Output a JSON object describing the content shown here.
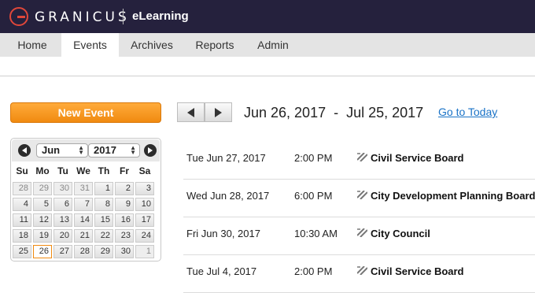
{
  "header": {
    "brand": "GRANICUS",
    "product": "eLearning"
  },
  "nav": {
    "tabs": [
      "Home",
      "Events",
      "Archives",
      "Reports",
      "Admin"
    ],
    "active": "Events"
  },
  "toolbar": {
    "new_event_label": "New Event",
    "date_range": "Jun 26, 2017  -  Jul 25, 2017",
    "go_to_today_label": "Go to Today"
  },
  "calendar": {
    "month": "Jun",
    "year": "2017",
    "weekdays": [
      "Su",
      "Mo",
      "Tu",
      "We",
      "Th",
      "Fr",
      "Sa"
    ],
    "weeks": [
      [
        "28",
        "29",
        "30",
        "31",
        "1",
        "2",
        "3"
      ],
      [
        "4",
        "5",
        "6",
        "7",
        "8",
        "9",
        "10"
      ],
      [
        "11",
        "12",
        "13",
        "14",
        "15",
        "16",
        "17"
      ],
      [
        "18",
        "19",
        "20",
        "21",
        "22",
        "23",
        "24"
      ],
      [
        "25",
        "26",
        "27",
        "28",
        "29",
        "30",
        "1"
      ]
    ],
    "today": "26"
  },
  "events": [
    {
      "date": "Tue Jun 27, 2017",
      "time": "2:00 PM",
      "title": "Civil Service Board"
    },
    {
      "date": "Wed Jun 28, 2017",
      "time": "6:00 PM",
      "title": "City Development Planning Board"
    },
    {
      "date": "Fri Jun 30, 2017",
      "time": "10:30 AM",
      "title": "City Council"
    },
    {
      "date": "Tue Jul 4, 2017",
      "time": "2:00 PM",
      "title": "Civil Service Board"
    }
  ],
  "colors": {
    "header_bg": "#25213d",
    "accent_orange": "#f08a10",
    "link_blue": "#1a73c7",
    "logo_red": "#e0473a"
  }
}
